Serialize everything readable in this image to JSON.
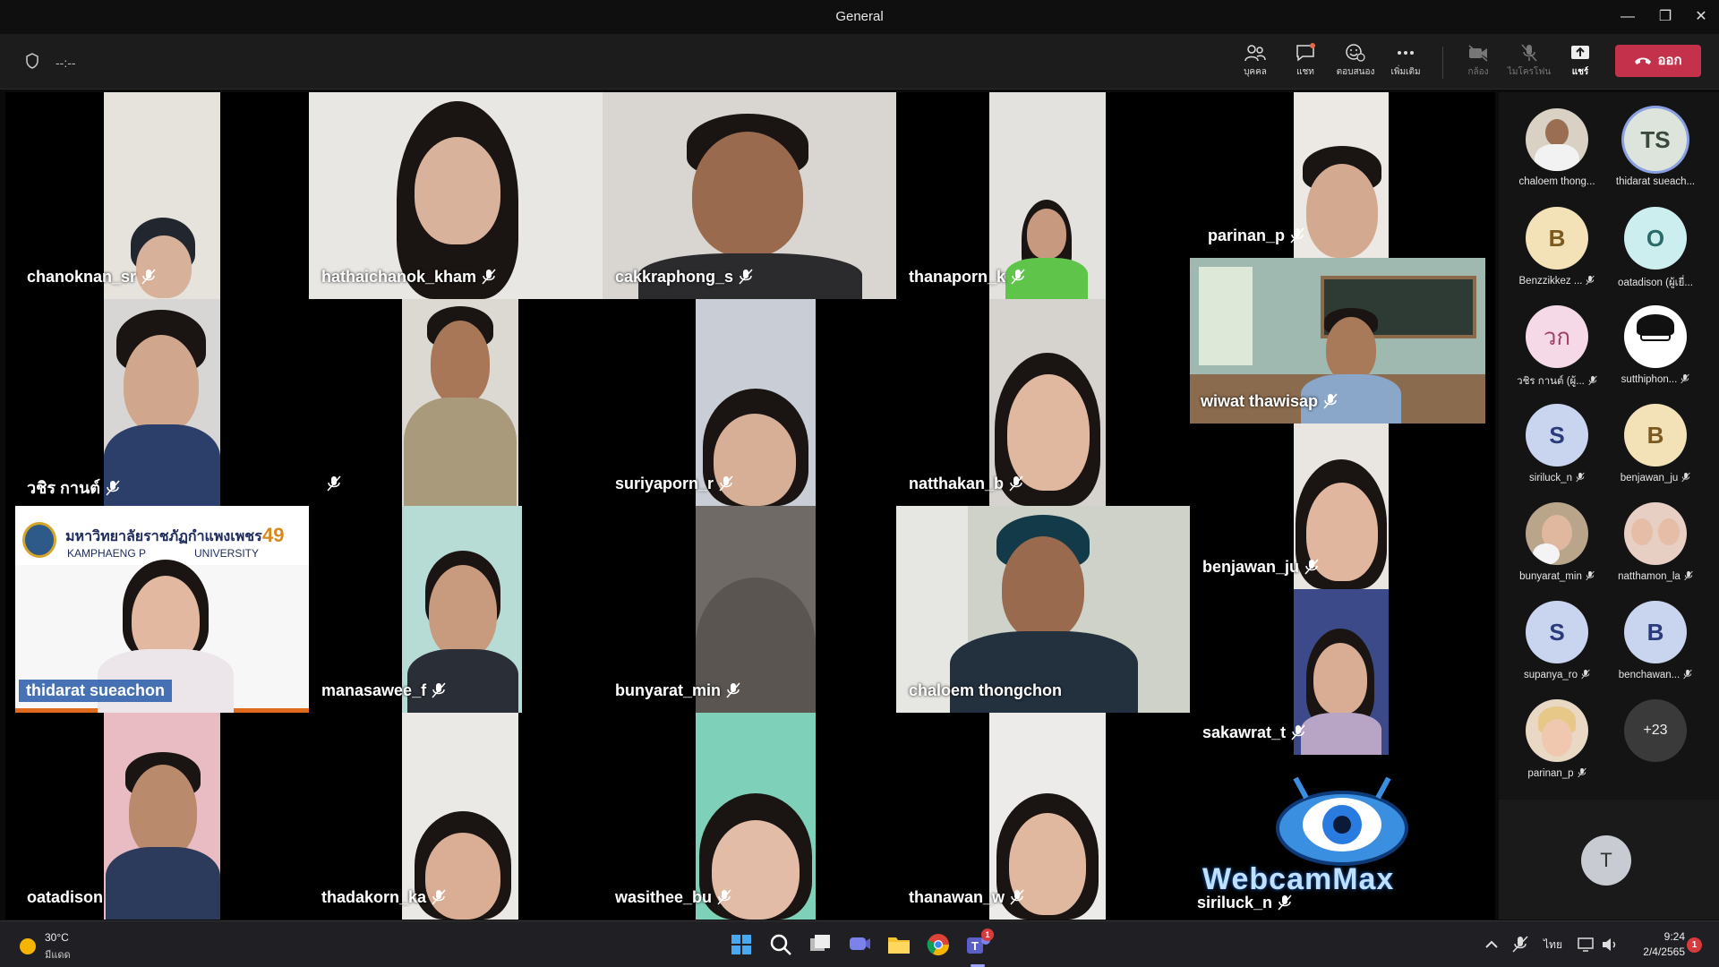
{
  "window": {
    "title": "General"
  },
  "toolbar": {
    "timer": "--:--",
    "people_label": "บุคคล",
    "chat_label": "แชท",
    "react_label": "ตอบสนอง",
    "more_label": "เพิ่มเติม",
    "camera_label": "กล้อง",
    "mic_label": "ไมโครโฟน",
    "share_label": "แชร์",
    "leave_label": "ออก"
  },
  "participants": [
    {
      "name": "chanoknan_sr"
    },
    {
      "name": "hathaichanok_kham"
    },
    {
      "name": "cakkraphong_s"
    },
    {
      "name": "thanaporn_k"
    },
    {
      "name": "parinan_p"
    },
    {
      "name": "วชิร กานต์"
    },
    {
      "name": ""
    },
    {
      "name": "suriyaporn_r"
    },
    {
      "name": "natthakan_b"
    },
    {
      "name": "wiwat thawisap"
    },
    {
      "name": "thidarat sueachon"
    },
    {
      "name": "manasawee_f"
    },
    {
      "name": "bunyarat_min"
    },
    {
      "name": "chaloem thongchon"
    },
    {
      "name": "benjawan_ju"
    },
    {
      "name": "sakawrat_t"
    },
    {
      "name": "oatadison"
    },
    {
      "name": "thadakorn_ka"
    },
    {
      "name": "wasithee_bu"
    },
    {
      "name": "thanawan_w"
    },
    {
      "name": "siriluck_n"
    }
  ],
  "banner": {
    "university_th": "มหาวิทยาลัยราชภัฏกำแพงเพชร",
    "university_en_1": "KAMPHAENG P",
    "university_en_2": "UNIVERSITY",
    "years": "49"
  },
  "watermark": "WebcamMax",
  "roster": [
    {
      "name": "chaloem thong...",
      "initials": "",
      "avatar_color": "#d9d2c4",
      "muted": false
    },
    {
      "name": "thidarat sueach...",
      "initials": "TS",
      "avatar_color": "#dde4dc",
      "muted": false
    },
    {
      "name": "Benzzikkez ...",
      "initials": "B",
      "avatar_color": "#f3e2b8",
      "muted": true
    },
    {
      "name": "oatadison (ผู้เยี่...",
      "initials": "O",
      "avatar_color": "#cdeeee",
      "muted": false
    },
    {
      "name": "วชิร กานต์ (ผู้...",
      "initials": "วก",
      "avatar_color": "#f5d9e6",
      "muted": true
    },
    {
      "name": "sutthiphon...",
      "initials": "",
      "avatar_color": "#ffffff",
      "muted": true
    },
    {
      "name": "siriluck_n",
      "initials": "S",
      "avatar_color": "#c9d4ee",
      "muted": true
    },
    {
      "name": "benjawan_ju",
      "initials": "B",
      "avatar_color": "#f3e2b8",
      "muted": true
    },
    {
      "name": "bunyarat_min",
      "initials": "",
      "avatar_color": "#b9a58a",
      "muted": true
    },
    {
      "name": "natthamon_la",
      "initials": "",
      "avatar_color": "#e8cfc4",
      "muted": true
    },
    {
      "name": "supanya_ro",
      "initials": "S",
      "avatar_color": "#c9d4ee",
      "muted": true
    },
    {
      "name": "benchawan...",
      "initials": "B",
      "avatar_color": "#c9d4ee",
      "muted": true
    },
    {
      "name": "parinan_p",
      "initials": "",
      "avatar_color": "#e8d8c4",
      "muted": true
    },
    {
      "name": "",
      "initials": "+23",
      "avatar_color": "#3a3a3a",
      "muted": false
    }
  ],
  "self_view": {
    "initials": "T"
  },
  "taskbar": {
    "temperature": "30°C",
    "condition": "มีแดด",
    "language": "ไทย",
    "time": "9:24",
    "date": "2/4/2565",
    "notifications": "1",
    "teams_badge": "1"
  }
}
